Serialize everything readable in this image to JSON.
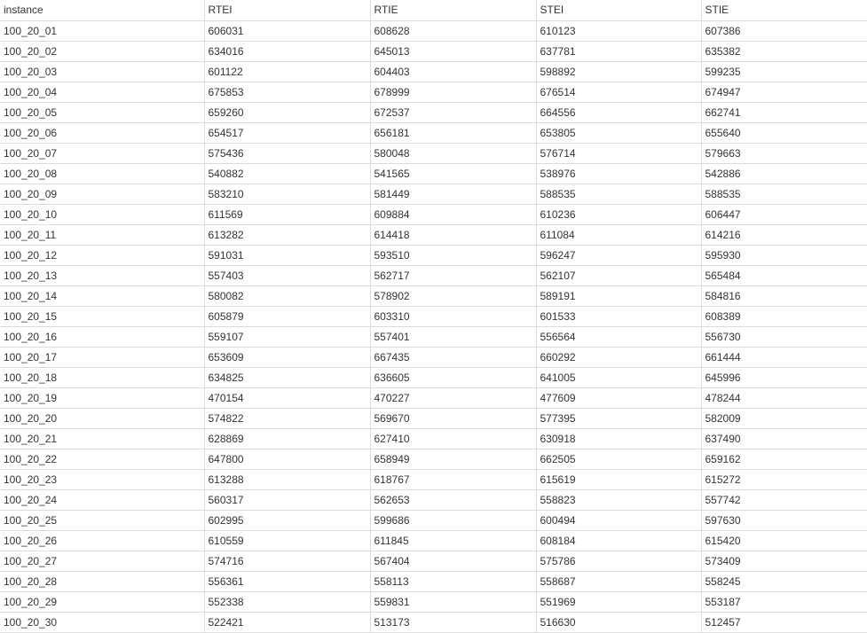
{
  "table": {
    "columns": [
      "instance",
      "RTEI",
      "RTIE",
      "STEI",
      "STIE"
    ],
    "rows": [
      [
        "100_20_01",
        "606031",
        "608628",
        "610123",
        "607386"
      ],
      [
        "100_20_02",
        "634016",
        "645013",
        "637781",
        "635382"
      ],
      [
        "100_20_03",
        "601122",
        "604403",
        "598892",
        "599235"
      ],
      [
        "100_20_04",
        "675853",
        "678999",
        "676514",
        "674947"
      ],
      [
        "100_20_05",
        "659260",
        "672537",
        "664556",
        "662741"
      ],
      [
        "100_20_06",
        "654517",
        "656181",
        "653805",
        "655640"
      ],
      [
        "100_20_07",
        "575436",
        "580048",
        "576714",
        "579663"
      ],
      [
        "100_20_08",
        "540882",
        "541565",
        "538976",
        "542886"
      ],
      [
        "100_20_09",
        "583210",
        "581449",
        "588535",
        "588535"
      ],
      [
        "100_20_10",
        "611569",
        "609884",
        "610236",
        "606447"
      ],
      [
        "100_20_11",
        "613282",
        "614418",
        "611084",
        "614216"
      ],
      [
        "100_20_12",
        "591031",
        "593510",
        "596247",
        "595930"
      ],
      [
        "100_20_13",
        "557403",
        "562717",
        "562107",
        "565484"
      ],
      [
        "100_20_14",
        "580082",
        "578902",
        "589191",
        "584816"
      ],
      [
        "100_20_15",
        "605879",
        "603310",
        "601533",
        "608389"
      ],
      [
        "100_20_16",
        "559107",
        "557401",
        "556564",
        "556730"
      ],
      [
        "100_20_17",
        "653609",
        "667435",
        "660292",
        "661444"
      ],
      [
        "100_20_18",
        "634825",
        "636605",
        "641005",
        "645996"
      ],
      [
        "100_20_19",
        "470154",
        "470227",
        "477609",
        "478244"
      ],
      [
        "100_20_20",
        "574822",
        "569670",
        "577395",
        "582009"
      ],
      [
        "100_20_21",
        "628869",
        "627410",
        "630918",
        "637490"
      ],
      [
        "100_20_22",
        "647800",
        "658949",
        "662505",
        "659162"
      ],
      [
        "100_20_23",
        "613288",
        "618767",
        "615619",
        "615272"
      ],
      [
        "100_20_24",
        "560317",
        "562653",
        "558823",
        "557742"
      ],
      [
        "100_20_25",
        "602995",
        "599686",
        "600494",
        "597630"
      ],
      [
        "100_20_26",
        "610559",
        "611845",
        "608184",
        "615420"
      ],
      [
        "100_20_27",
        "574716",
        "567404",
        "575786",
        "573409"
      ],
      [
        "100_20_28",
        "556361",
        "558113",
        "558687",
        "558245"
      ],
      [
        "100_20_29",
        "552338",
        "559831",
        "551969",
        "553187"
      ],
      [
        "100_20_30",
        "522421",
        "513173",
        "516630",
        "512457"
      ]
    ]
  }
}
